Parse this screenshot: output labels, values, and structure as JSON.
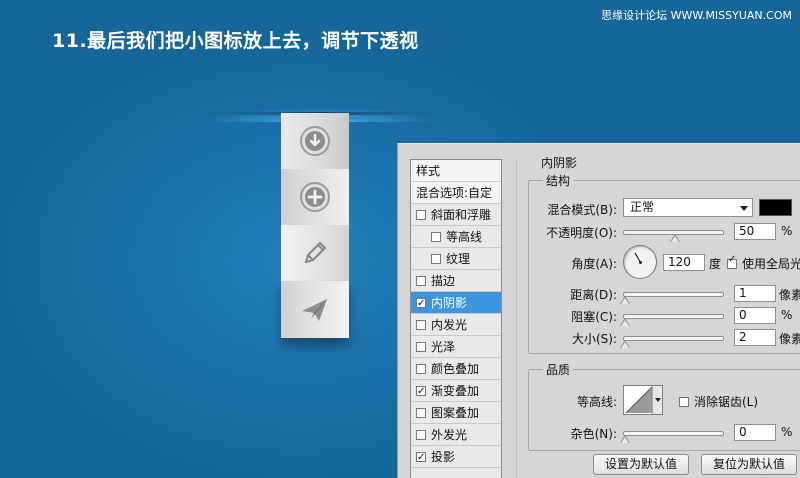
{
  "header": {
    "step_title": "11.最后我们把小图标放上去，调节下透视",
    "watermark": "思缘设计论坛 WWW.MISSYUAN.COM"
  },
  "icon_strip": {
    "icons": [
      "download-icon",
      "plus-circle-icon",
      "pencil-icon",
      "paper-plane-icon"
    ]
  },
  "layer_style": {
    "style_list": [
      {
        "label": "样式",
        "type": "header"
      },
      {
        "label": "混合选项:自定",
        "type": "header"
      },
      {
        "label": "斜面和浮雕",
        "checked": false
      },
      {
        "label": "等高线",
        "checked": false,
        "indent": true
      },
      {
        "label": "纹理",
        "checked": false,
        "indent": true
      },
      {
        "label": "描边",
        "checked": false
      },
      {
        "label": "内阴影",
        "checked": true,
        "selected": true
      },
      {
        "label": "内发光",
        "checked": false
      },
      {
        "label": "光泽",
        "checked": false
      },
      {
        "label": "颜色叠加",
        "checked": false
      },
      {
        "label": "渐变叠加",
        "checked": true
      },
      {
        "label": "图案叠加",
        "checked": false
      },
      {
        "label": "外发光",
        "checked": false
      },
      {
        "label": "投影",
        "checked": true
      }
    ],
    "panel_title": "内阴影",
    "structure": {
      "group_title": "结构",
      "blend_mode_label": "混合模式(B):",
      "blend_mode_value": "正常",
      "shadow_color": "#000000",
      "opacity_label": "不透明度(O):",
      "opacity_value": "50",
      "opacity_unit": "%",
      "opacity_fraction": 0.5,
      "angle_label": "角度(A):",
      "angle_value": "120",
      "angle_unit": "度",
      "angle_degrees": 120,
      "global_light_label": "使用全局光",
      "global_light_checked": true,
      "distance_label": "距离(D):",
      "distance_value": "1",
      "distance_unit": "像素",
      "choke_label": "阻塞(C):",
      "choke_value": "0",
      "choke_unit": "%",
      "size_label": "大小(S):",
      "size_value": "2",
      "size_unit": "像素"
    },
    "quality": {
      "group_title": "品质",
      "contour_label": "等高线:",
      "anti_alias_label": "消除锯齿(L)",
      "anti_alias_checked": false,
      "noise_label": "杂色(N):",
      "noise_value": "0",
      "noise_unit": "%"
    },
    "buttons": {
      "make_default": "设置为默认值",
      "reset_default": "复位为默认值"
    }
  }
}
